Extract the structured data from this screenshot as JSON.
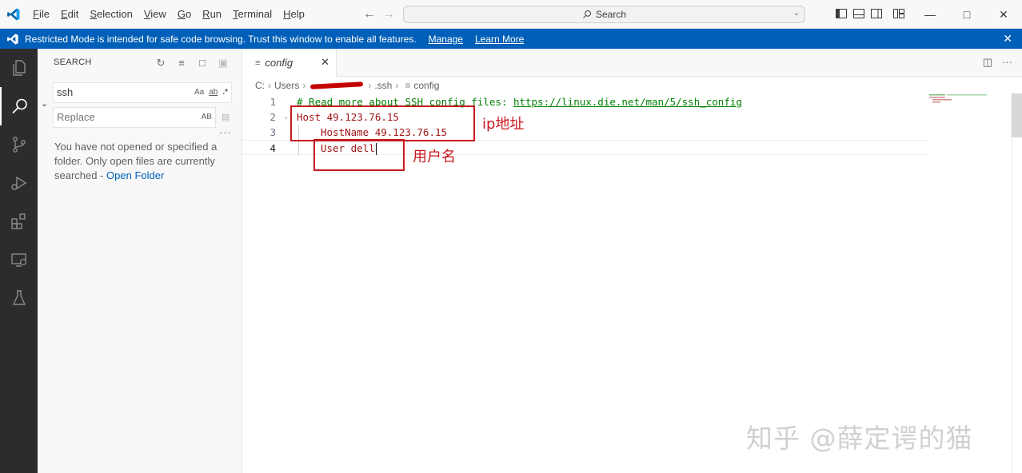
{
  "menu": {
    "items": [
      "File",
      "Edit",
      "Selection",
      "View",
      "Go",
      "Run",
      "Terminal",
      "Help"
    ],
    "mnemonics": [
      "F",
      "E",
      "S",
      "V",
      "G",
      "R",
      "T",
      "H"
    ]
  },
  "command_center": {
    "label": "Search"
  },
  "banner": {
    "message": "Restricted Mode is intended for safe code browsing. Trust this window to enable all features.",
    "manage_label": "Manage",
    "learn_more_label": "Learn More",
    "color": "#005fb8"
  },
  "activity_bar": {
    "items": [
      "explorer-icon",
      "search-icon",
      "source-control-icon",
      "run-debug-icon",
      "extensions-icon",
      "remote-explorer-icon",
      "testing-icon"
    ],
    "active": "search-icon"
  },
  "sidebar": {
    "title": "SEARCH",
    "search_value": "ssh",
    "search_options": [
      "Aa",
      "ab",
      ".*"
    ],
    "replace_placeholder": "Replace",
    "replace_option": "AB",
    "message_text": "You have not opened or specified a folder. Only open files are currently searched - ",
    "open_folder_label": "Open Folder"
  },
  "editor": {
    "tab_label": "config",
    "breadcrumb": [
      "C:",
      "Users",
      ".ssh",
      "config"
    ],
    "lines": [
      {
        "n": "1",
        "comment": "# Read more about SSH config files: ",
        "url": "https://linux.die.net/man/5/ssh_config"
      },
      {
        "n": "2",
        "text": "Host 49.123.76.15"
      },
      {
        "n": "3",
        "text": "HostName 49.123.76.15"
      },
      {
        "n": "4",
        "text": "User dell"
      }
    ]
  },
  "annotations": {
    "ip_label": "ip地址",
    "user_label": "用户名",
    "color": "#c8181e"
  },
  "watermark": "知乎 @薛定谔的猫"
}
